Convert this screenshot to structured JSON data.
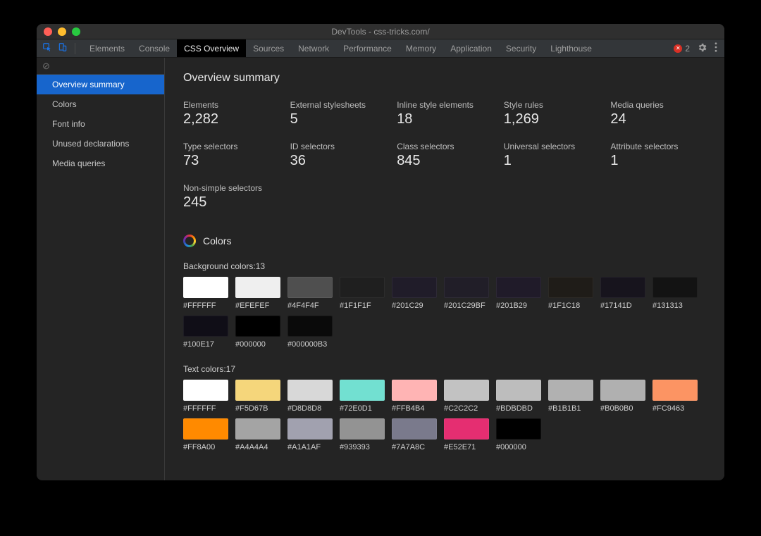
{
  "window_title": "DevTools - css-tricks.com/",
  "toolbar": {
    "error_count": "2"
  },
  "tabs": [
    {
      "label": "Elements",
      "active": false
    },
    {
      "label": "Console",
      "active": false
    },
    {
      "label": "CSS Overview",
      "active": true
    },
    {
      "label": "Sources",
      "active": false
    },
    {
      "label": "Network",
      "active": false
    },
    {
      "label": "Performance",
      "active": false
    },
    {
      "label": "Memory",
      "active": false
    },
    {
      "label": "Application",
      "active": false
    },
    {
      "label": "Security",
      "active": false
    },
    {
      "label": "Lighthouse",
      "active": false
    }
  ],
  "sidebar": {
    "clear_icon": "⊘",
    "items": [
      {
        "label": "Overview summary",
        "active": true
      },
      {
        "label": "Colors",
        "active": false
      },
      {
        "label": "Font info",
        "active": false
      },
      {
        "label": "Unused declarations",
        "active": false
      },
      {
        "label": "Media queries",
        "active": false
      }
    ]
  },
  "overview": {
    "title": "Overview summary",
    "stats": [
      {
        "label": "Elements",
        "value": "2,282"
      },
      {
        "label": "External stylesheets",
        "value": "5"
      },
      {
        "label": "Inline style elements",
        "value": "18"
      },
      {
        "label": "Style rules",
        "value": "1,269"
      },
      {
        "label": "Media queries",
        "value": "24"
      },
      {
        "label": "Type selectors",
        "value": "73"
      },
      {
        "label": "ID selectors",
        "value": "36"
      },
      {
        "label": "Class selectors",
        "value": "845"
      },
      {
        "label": "Universal selectors",
        "value": "1"
      },
      {
        "label": "Attribute selectors",
        "value": "1"
      },
      {
        "label": "Non-simple selectors",
        "value": "245"
      }
    ]
  },
  "colors": {
    "section_title": "Colors",
    "background": {
      "label": "Background colors:13",
      "swatches": [
        {
          "hex": "#FFFFFF"
        },
        {
          "hex": "#EFEFEF"
        },
        {
          "hex": "#4F4F4F"
        },
        {
          "hex": "#1F1F1F"
        },
        {
          "hex": "#201C29"
        },
        {
          "hex": "#201C29BF"
        },
        {
          "hex": "#201B29"
        },
        {
          "hex": "#1F1C18"
        },
        {
          "hex": "#17141D"
        },
        {
          "hex": "#131313"
        },
        {
          "hex": "#100E17"
        },
        {
          "hex": "#000000"
        },
        {
          "hex": "#000000B3"
        }
      ]
    },
    "text": {
      "label": "Text colors:17",
      "swatches": [
        {
          "hex": "#FFFFFF"
        },
        {
          "hex": "#F5D67B"
        },
        {
          "hex": "#D8D8D8"
        },
        {
          "hex": "#72E0D1"
        },
        {
          "hex": "#FFB4B4"
        },
        {
          "hex": "#C2C2C2"
        },
        {
          "hex": "#BDBDBD"
        },
        {
          "hex": "#B1B1B1"
        },
        {
          "hex": "#B0B0B0"
        },
        {
          "hex": "#FC9463"
        },
        {
          "hex": "#FF8A00"
        },
        {
          "hex": "#A4A4A4"
        },
        {
          "hex": "#A1A1AF"
        },
        {
          "hex": "#939393"
        },
        {
          "hex": "#7A7A8C"
        },
        {
          "hex": "#E52E71"
        },
        {
          "hex": "#000000"
        }
      ]
    }
  }
}
